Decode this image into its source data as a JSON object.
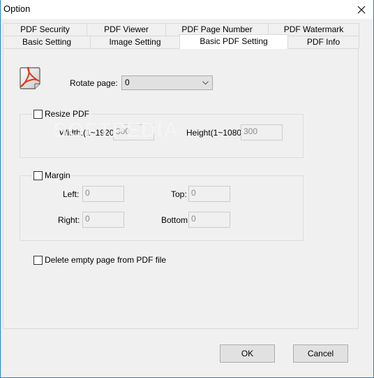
{
  "window": {
    "title": "Option",
    "close_icon": "close-icon"
  },
  "tabs": {
    "row1": [
      {
        "label": "PDF Security"
      },
      {
        "label": "PDF Viewer"
      },
      {
        "label": "PDF Page Number"
      },
      {
        "label": "PDF Watermark"
      }
    ],
    "row2": [
      {
        "label": "Basic Setting"
      },
      {
        "label": "Image Setting"
      },
      {
        "label": "Basic PDF Setting",
        "active": true
      },
      {
        "label": "PDF Info"
      }
    ]
  },
  "panel": {
    "pdf_icon": "pdf-document-icon",
    "rotate": {
      "label": "Rotate page:",
      "value": "0"
    },
    "resize": {
      "checkbox_label": "Resize PDF",
      "checked": false,
      "width_label": "Width:(1~1920)",
      "width_value": "300",
      "height_label": "Height(1~1080)",
      "height_value": "300"
    },
    "margin": {
      "checkbox_label": "Margin",
      "checked": false,
      "left_label": "Left:",
      "left_value": "0",
      "top_label": "Top:",
      "top_value": "0",
      "right_label": "Right:",
      "right_value": "0",
      "bottom_label": "Bottom:",
      "bottom_value": "0"
    },
    "delete_empty": {
      "label": "Delete empty page from PDF file",
      "checked": false
    }
  },
  "buttons": {
    "ok": "OK",
    "cancel": "Cancel"
  },
  "watermark": "SOFTPEDIA"
}
